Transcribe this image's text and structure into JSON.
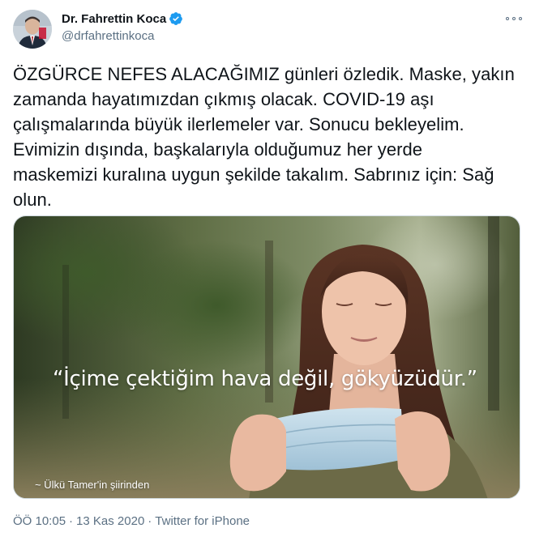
{
  "author": {
    "display_name": "Dr. Fahrettin Koca",
    "handle": "@drfahrettinkoca",
    "verified": true
  },
  "tweet": {
    "text_lines": [
      "ÖZGÜRCE NEFES ALACAĞIMIZ günleri özledik. Maske, yakın",
      "zamanda hayatımızdan çıkmış olacak. COVID-19 aşı",
      "çalışmalarında büyük ilerlemeler var. Sonucu bekleyelim.",
      "Evimizin dışında, başkalarıyla olduğumuz her yerde",
      "maskemizi kuralına uygun şekilde takalım. Sabrınız için: Sağ",
      "olun."
    ]
  },
  "media": {
    "quote": "“İçime çektiğim hava değil, gökyüzüdür.”",
    "credit": "~ Ülkü Tamer'in şiirinden"
  },
  "meta": {
    "time": "ÖÖ 10:05",
    "separator": "·",
    "date": "13 Kas 2020",
    "source": "Twitter for iPhone"
  },
  "colors": {
    "verified_blue": "#1d9bf0",
    "secondary_text": "#5b7083",
    "border": "#cfd9de"
  },
  "icons": {
    "verified": "verified-badge-icon",
    "more": "more-options-icon"
  }
}
